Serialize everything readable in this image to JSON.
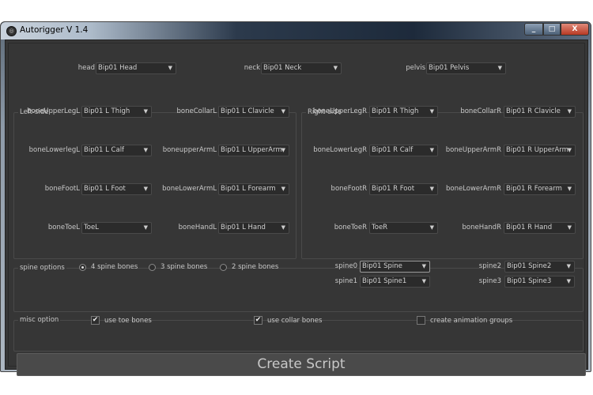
{
  "window": {
    "title": "Autorigger V 1.4",
    "minimize": "_",
    "maximize": "□",
    "close": "X"
  },
  "top": [
    {
      "label": "head",
      "value": "Bip01 Head"
    },
    {
      "label": "neck",
      "value": "Bip01 Neck"
    },
    {
      "label": "pelvis",
      "value": "Bip01 Pelvis"
    }
  ],
  "left_side": {
    "title": "Left-side",
    "rows": [
      [
        {
          "label": "boneUpperLegL",
          "value": "Bip01 L Thigh"
        },
        {
          "label": "boneCollarL",
          "value": "Bip01 L Clavicle"
        }
      ],
      [
        {
          "label": "boneLowerlegL",
          "value": "Bip01 L Calf"
        },
        {
          "label": "boneupperArmL",
          "value": "Bip01 L UpperArm"
        }
      ],
      [
        {
          "label": "boneFootL",
          "value": "Bip01 L Foot"
        },
        {
          "label": "boneLowerArmL",
          "value": "Bip01 L Forearm"
        }
      ],
      [
        {
          "label": "boneToeL",
          "value": "ToeL"
        },
        {
          "label": "boneHandL",
          "value": "Bip01 L Hand"
        }
      ]
    ]
  },
  "right_side": {
    "title": "Right-side",
    "rows": [
      [
        {
          "label": "boneUpperLegR",
          "value": "Bip01 R Thigh"
        },
        {
          "label": "boneCollarR",
          "value": "Bip01 R Clavicle"
        }
      ],
      [
        {
          "label": "boneLowerLegR",
          "value": "Bip01 R Calf"
        },
        {
          "label": "boneUpperArmR",
          "value": "Bip01 R UpperArm"
        }
      ],
      [
        {
          "label": "boneFootR",
          "value": "Bip01 R Foot"
        },
        {
          "label": "boneLowerArmR",
          "value": "Bip01 R Forearm"
        }
      ],
      [
        {
          "label": "boneToeR",
          "value": "ToeR"
        },
        {
          "label": "boneHandR",
          "value": "Bip01 R Hand"
        }
      ]
    ]
  },
  "spine": {
    "title": "spine options",
    "radios": [
      {
        "label": "4 spine bones",
        "selected": true
      },
      {
        "label": "3 spine bones",
        "selected": false
      },
      {
        "label": "2 spine bones",
        "selected": false
      }
    ],
    "combos": [
      {
        "label": "spine0",
        "value": "Bip01 Spine"
      },
      {
        "label": "spine1",
        "value": "Bip01 Spine1"
      },
      {
        "label": "spine2",
        "value": "Bip01 Spine2"
      },
      {
        "label": "spine3",
        "value": "Bip01 Spine3"
      }
    ]
  },
  "misc": {
    "title": "misc option",
    "checks": [
      {
        "label": "use toe bones",
        "checked": true
      },
      {
        "label": "use collar bones",
        "checked": true
      },
      {
        "label": "create animation groups",
        "checked": false
      }
    ]
  },
  "create_button": "Create Script",
  "icons": {
    "dropdown": "▼",
    "check": "✔"
  }
}
